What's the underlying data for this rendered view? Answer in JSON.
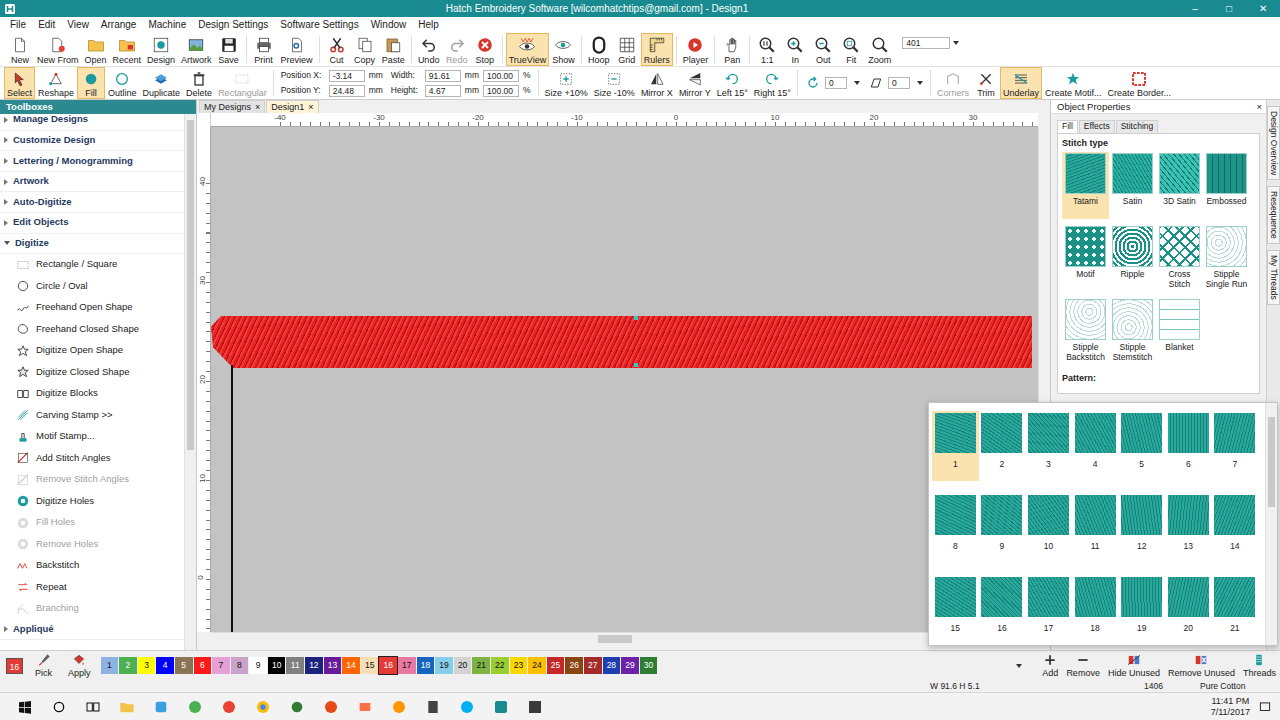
{
  "window": {
    "title": "Hatch Embroidery Software [wilcomhatchtips@gmail.com] - Design1",
    "controls": [
      "–",
      "□",
      "✕"
    ]
  },
  "menu": [
    "File",
    "Edit",
    "View",
    "Arrange",
    "Machine",
    "Design Settings",
    "Software Settings",
    "Window",
    "Help"
  ],
  "toolbar": [
    {
      "label": "New",
      "selected": false,
      "disabled": false
    },
    {
      "label": "New From",
      "selected": false,
      "disabled": false
    },
    {
      "label": "Open",
      "selected": false,
      "disabled": false
    },
    {
      "label": "Recent",
      "selected": false,
      "disabled": false
    },
    {
      "label": "Design",
      "selected": false,
      "disabled": false
    },
    {
      "label": "Artwork",
      "selected": false,
      "disabled": false
    },
    {
      "label": "Save",
      "selected": false,
      "disabled": false
    },
    {
      "label": "Print",
      "selected": false,
      "disabled": false
    },
    {
      "label": "Preview",
      "selected": false,
      "disabled": false
    },
    {
      "label": "Cut",
      "selected": false,
      "disabled": false
    },
    {
      "label": "Copy",
      "selected": false,
      "disabled": false
    },
    {
      "label": "Paste",
      "selected": false,
      "disabled": false
    },
    {
      "label": "Undo",
      "selected": false,
      "disabled": false
    },
    {
      "label": "Redo",
      "selected": false,
      "disabled": true
    },
    {
      "label": "Stop",
      "selected": false,
      "disabled": false
    },
    {
      "label": "TrueView",
      "selected": true,
      "disabled": false
    },
    {
      "label": "Show",
      "selected": false,
      "disabled": false
    },
    {
      "label": "Hoop",
      "selected": false,
      "disabled": false
    },
    {
      "label": "Grid",
      "selected": false,
      "disabled": false
    },
    {
      "label": "Rulers",
      "selected": true,
      "disabled": false
    },
    {
      "label": "Player",
      "selected": false,
      "disabled": false
    },
    {
      "label": "Pan",
      "selected": false,
      "disabled": false
    },
    {
      "label": "1:1",
      "selected": false,
      "disabled": false
    },
    {
      "label": "In",
      "selected": false,
      "disabled": false
    },
    {
      "label": "Out",
      "selected": false,
      "disabled": false
    },
    {
      "label": "Fit",
      "selected": false,
      "disabled": false
    },
    {
      "label": "Zoom",
      "selected": false,
      "disabled": false
    }
  ],
  "zoom_field": {
    "value": "401"
  },
  "edit_tools": [
    {
      "label": "Select",
      "selected": true,
      "disabled": false
    },
    {
      "label": "Reshape",
      "selected": false,
      "disabled": false
    },
    {
      "label": "Fill",
      "selected": true,
      "disabled": false
    },
    {
      "label": "Outline",
      "selected": false,
      "disabled": false
    },
    {
      "label": "Duplicate",
      "selected": false,
      "disabled": false
    },
    {
      "label": "Delete",
      "selected": false,
      "disabled": false
    },
    {
      "label": "Rectangular",
      "selected": false,
      "disabled": true
    }
  ],
  "position_fields": [
    {
      "label": "Position X:",
      "value": "-3.14",
      "unit": "mm"
    },
    {
      "label": "Position Y:",
      "value": "24.48",
      "unit": "mm"
    }
  ],
  "size_fields": [
    {
      "label": "Width:",
      "value": "91.61",
      "unit": "mm",
      "scale": "100.00",
      "scale_unit": "%"
    },
    {
      "label": "Height:",
      "value": "4.67",
      "unit": "mm",
      "scale": "100.00",
      "scale_unit": "%"
    }
  ],
  "transform_tools": [
    {
      "label": "Size +10%",
      "selected": false,
      "disabled": false
    },
    {
      "label": "Size -10%",
      "selected": false,
      "disabled": false
    },
    {
      "label": "Mirror X",
      "selected": false,
      "disabled": false
    },
    {
      "label": "Mirror Y",
      "selected": false,
      "disabled": false
    },
    {
      "label": "Left 15°",
      "selected": false,
      "disabled": false
    },
    {
      "label": "Right 15°",
      "selected": false,
      "disabled": false
    }
  ],
  "rotation_fields": [
    "0",
    "0"
  ],
  "more_tools": [
    {
      "label": "Corners",
      "selected": false,
      "disabled": true
    },
    {
      "label": "Trim",
      "selected": false,
      "disabled": false
    },
    {
      "label": "Underlay",
      "selected": true,
      "disabled": false
    },
    {
      "label": "Create Motif...",
      "selected": false,
      "disabled": false
    },
    {
      "label": "Create Border...",
      "selected": false,
      "disabled": false
    }
  ],
  "toolboxes": {
    "title": "Toolboxes",
    "sections": [
      {
        "label": "Manage Designs",
        "expanded": false,
        "items": []
      },
      {
        "label": "Customize Design",
        "expanded": false,
        "items": []
      },
      {
        "label": "Lettering / Monogramming",
        "expanded": false,
        "items": []
      },
      {
        "label": "Artwork",
        "expanded": false,
        "items": []
      },
      {
        "label": "Auto-Digitize",
        "expanded": false,
        "items": []
      },
      {
        "label": "Edit Objects",
        "expanded": false,
        "items": []
      },
      {
        "label": "Digitize",
        "expanded": true,
        "items": [
          {
            "label": "Rectangle / Square",
            "disabled": false
          },
          {
            "label": "Circle / Oval",
            "disabled": false
          },
          {
            "label": "Freehand Open Shape",
            "disabled": false
          },
          {
            "label": "Freehand Closed Shape",
            "disabled": false
          },
          {
            "label": "Digitize Open Shape",
            "disabled": false
          },
          {
            "label": "Digitize Closed Shape",
            "disabled": false
          },
          {
            "label": "Digitize Blocks",
            "disabled": false
          },
          {
            "label": "Carving Stamp >>",
            "disabled": false
          },
          {
            "label": "Motif Stamp...",
            "disabled": false
          },
          {
            "label": "Add Stitch Angles",
            "disabled": false
          },
          {
            "label": "Remove Stitch Angles",
            "disabled": true
          },
          {
            "label": "Digitize Holes",
            "disabled": false
          },
          {
            "label": "Fill Holes",
            "disabled": true
          },
          {
            "label": "Remove Holes",
            "disabled": true
          },
          {
            "label": "Backstitch",
            "disabled": false
          },
          {
            "label": "Repeat",
            "disabled": false
          },
          {
            "label": "Branching",
            "disabled": true
          }
        ]
      },
      {
        "label": "Appliqué",
        "expanded": false,
        "items": []
      }
    ]
  },
  "doc_tabs": [
    {
      "label": "My Designs",
      "close": "×",
      "selected": false
    },
    {
      "label": "Design1",
      "close": "×",
      "selected": true
    }
  ],
  "rulers": {
    "horizontal": [
      "-40",
      "-30",
      "-20",
      "-10",
      "0",
      "10",
      "20",
      "30"
    ],
    "vertical": [
      "40",
      "30",
      "20",
      "10",
      "0"
    ]
  },
  "object_properties": {
    "title": "Object Properties",
    "close": "×",
    "tabs": [
      {
        "label": "Fill",
        "selected": true
      },
      {
        "label": "Effects",
        "selected": false
      },
      {
        "label": "Stitching",
        "selected": false
      }
    ],
    "group_label": "Stitch type",
    "stitch_types": [
      {
        "label": "Tatami",
        "selected": true
      },
      {
        "label": "Satin",
        "selected": false
      },
      {
        "label": "3D Satin",
        "selected": false
      },
      {
        "label": "Embossed",
        "selected": false
      },
      {
        "label": "Motif",
        "selected": false
      },
      {
        "label": "Ripple",
        "selected": false
      },
      {
        "label": "Cross Stitch",
        "selected": false
      },
      {
        "label": "Stipple Single Run",
        "selected": false
      },
      {
        "label": "Stipple Backstitch",
        "selected": false
      },
      {
        "label": "Stipple Stemstitch",
        "selected": false
      },
      {
        "label": "Blanket",
        "selected": false
      }
    ],
    "pattern_label": "Pattern:"
  },
  "pattern_popup": {
    "patterns": [
      {
        "label": "1",
        "selected": true
      },
      {
        "label": "2",
        "selected": false
      },
      {
        "label": "3",
        "selected": false
      },
      {
        "label": "4",
        "selected": false
      },
      {
        "label": "5",
        "selected": false
      },
      {
        "label": "6",
        "selected": false
      },
      {
        "label": "7",
        "selected": false
      },
      {
        "label": "8",
        "selected": false
      },
      {
        "label": "9",
        "selected": false
      },
      {
        "label": "10",
        "selected": false
      },
      {
        "label": "11",
        "selected": false
      },
      {
        "label": "12",
        "selected": false
      },
      {
        "label": "13",
        "selected": false
      },
      {
        "label": "14",
        "selected": false
      },
      {
        "label": "15",
        "selected": false
      },
      {
        "label": "16",
        "selected": false
      },
      {
        "label": "17",
        "selected": false
      },
      {
        "label": "18",
        "selected": false
      },
      {
        "label": "19",
        "selected": false
      },
      {
        "label": "20",
        "selected": false
      },
      {
        "label": "21",
        "selected": false
      }
    ]
  },
  "side_tabs": [
    "Design Overview",
    "Resequence",
    "My Threads"
  ],
  "palette": {
    "current": {
      "label": "16",
      "color": "#e53935"
    },
    "tools": [
      "Pick",
      "Apply"
    ],
    "swatches": [
      {
        "label": "1",
        "color": "#8db3e2",
        "selected": false
      },
      {
        "label": "2",
        "color": "#4caf50",
        "selected": false
      },
      {
        "label": "3",
        "color": "#ffff00",
        "selected": false
      },
      {
        "label": "4",
        "color": "#0000ff",
        "selected": false
      },
      {
        "label": "5",
        "color": "#8b7355",
        "selected": false
      },
      {
        "label": "6",
        "color": "#ff1a1a",
        "selected": false
      },
      {
        "label": "7",
        "color": "#e6a0d8",
        "selected": false
      },
      {
        "label": "8",
        "color": "#c8a2c8",
        "selected": false
      },
      {
        "label": "9",
        "color": "#ffffff",
        "selected": false
      },
      {
        "label": "10",
        "color": "#000000",
        "selected": false
      },
      {
        "label": "11",
        "color": "#808080",
        "selected": false
      },
      {
        "label": "12",
        "color": "#1a237e",
        "selected": false
      },
      {
        "label": "13",
        "color": "#6a1b9a",
        "selected": false
      },
      {
        "label": "14",
        "color": "#ff6600",
        "selected": false
      },
      {
        "label": "15",
        "color": "#f5deb3",
        "selected": false
      },
      {
        "label": "16",
        "color": "#e53935",
        "selected": true
      },
      {
        "label": "17",
        "color": "#e879a0",
        "selected": false
      },
      {
        "label": "18",
        "color": "#1565c0",
        "selected": false
      },
      {
        "label": "19",
        "color": "#87ceeb",
        "selected": false
      },
      {
        "label": "20",
        "color": "#d3d3d3",
        "selected": false
      },
      {
        "label": "21",
        "color": "#7cb342",
        "selected": false
      },
      {
        "label": "22",
        "color": "#9acd32",
        "selected": false
      },
      {
        "label": "23",
        "color": "#ffd700",
        "selected": false
      },
      {
        "label": "24",
        "color": "#ffc000",
        "selected": false
      },
      {
        "label": "25",
        "color": "#c62828",
        "selected": false
      },
      {
        "label": "26",
        "color": "#8b4513",
        "selected": false
      },
      {
        "label": "27",
        "color": "#a52a2a",
        "selected": false
      },
      {
        "label": "28",
        "color": "#1e40af",
        "selected": false
      },
      {
        "label": "29",
        "color": "#6b21a8",
        "selected": false
      },
      {
        "label": "30",
        "color": "#2e7d32",
        "selected": false
      }
    ],
    "actions": [
      "Add",
      "Remove",
      "Hide Unused",
      "Remove Unused",
      "Threads"
    ]
  },
  "status_bar": [
    "W 91.6 H 5.1",
    "1406",
    "Pure Cotton"
  ],
  "taskbar": {
    "time": "11:41 PM",
    "date": "7/11/2017"
  }
}
